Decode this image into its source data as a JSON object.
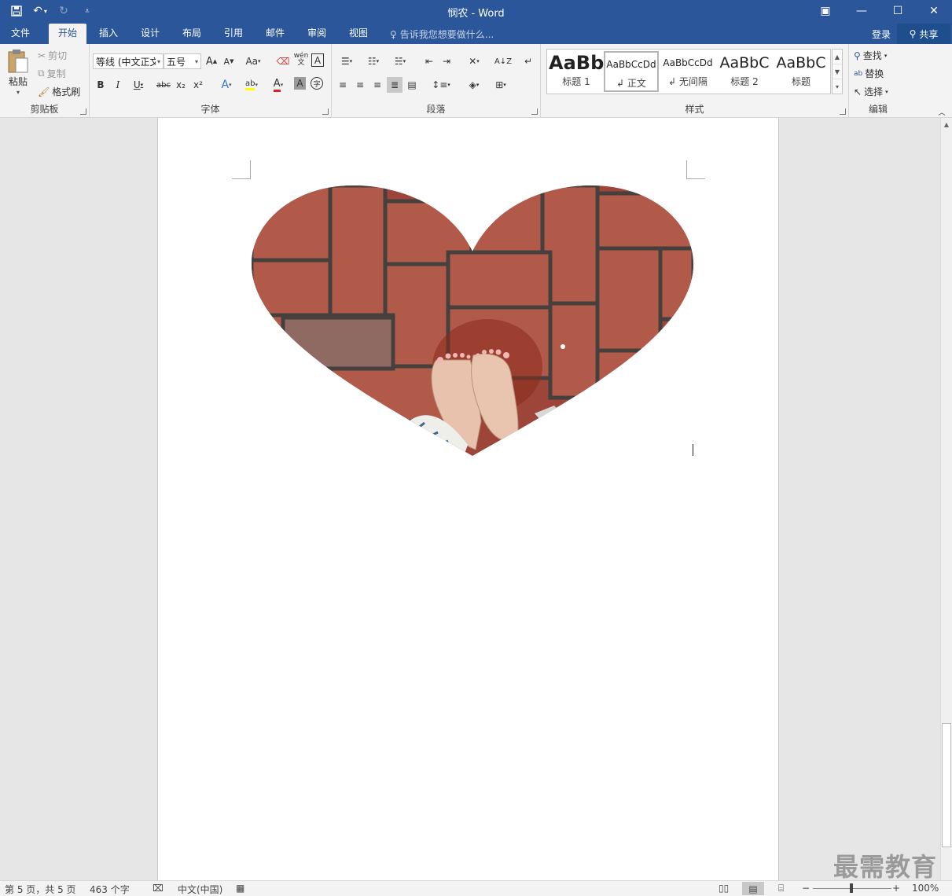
{
  "window": {
    "title": "悯农 - Word",
    "restore_ribbon_label": "▣",
    "minimize_label": "—",
    "maximize_label": "☐",
    "close_label": "✕"
  },
  "qat": {
    "save_icon": "save-icon",
    "undo_icon": "undo-icon",
    "redo_icon": "redo-icon",
    "customize_icon": "customize-qat-icon"
  },
  "tabs": [
    {
      "label": "文件"
    },
    {
      "label": "开始"
    },
    {
      "label": "插入"
    },
    {
      "label": "设计"
    },
    {
      "label": "布局"
    },
    {
      "label": "引用"
    },
    {
      "label": "邮件"
    },
    {
      "label": "审阅"
    },
    {
      "label": "视图"
    }
  ],
  "tell_me": {
    "placeholder": "告诉我您想要做什么..."
  },
  "account": {
    "login": "登录",
    "share": "共享"
  },
  "clipboard": {
    "paste": "粘贴",
    "cut": "剪切",
    "copy": "复制",
    "format_painter": "格式刷",
    "label": "剪贴板"
  },
  "font": {
    "name": "等线 (中文正文",
    "size": "五号",
    "grow": "A",
    "shrink": "A",
    "case": "Aa",
    "phonetic": "wén",
    "border_char": "A",
    "bold": "B",
    "italic": "I",
    "underline": "U",
    "strike": "abc",
    "sub": "x₂",
    "sup": "x²",
    "effects": "A",
    "highlight": "ab",
    "color": "A",
    "shading": "A",
    "enclose": "字",
    "label": "字体",
    "highlight_color": "#ffff00",
    "font_color": "#e02020"
  },
  "paragraph": {
    "label": "段落"
  },
  "styles": {
    "label": "样式",
    "items": [
      {
        "preview": "AaBb",
        "name": "标题 1"
      },
      {
        "preview": "AaBbCcDd",
        "name": "正文"
      },
      {
        "preview": "AaBbCcDd",
        "name": "无间隔"
      },
      {
        "preview": "AaBbC",
        "name": "标题 2"
      },
      {
        "preview": "AaBbC",
        "name": "标题"
      }
    ]
  },
  "editing": {
    "find": "查找",
    "replace": "替换",
    "select": "选择",
    "label": "编辑"
  },
  "status": {
    "page": "第 5 页，共 5 页",
    "words": "463 个字",
    "language": "中文(中国)",
    "zoom": "100%",
    "zoom_out": "−",
    "zoom_in": "+"
  },
  "watermark": "最需教育",
  "colors": {
    "accent": "#2b579a",
    "brick": "#a8473a",
    "mortar": "#4a4a4a"
  }
}
